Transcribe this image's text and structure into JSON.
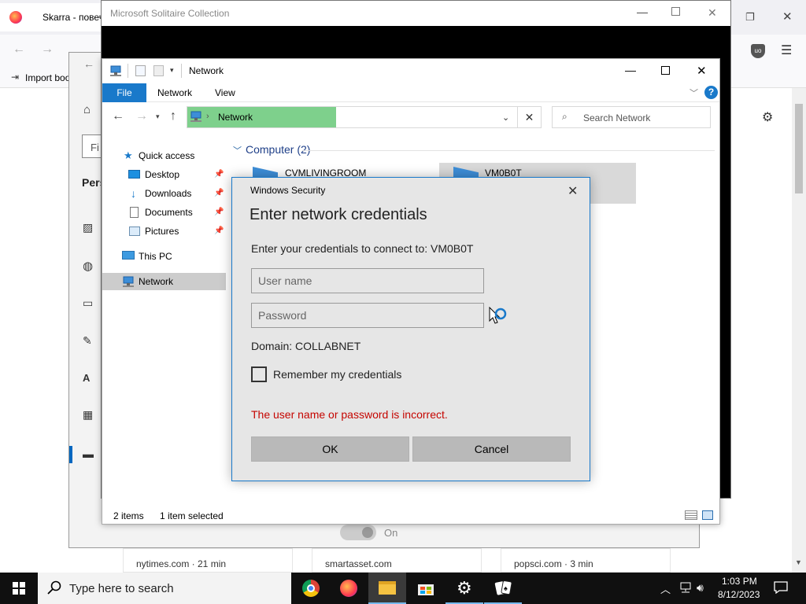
{
  "browser": {
    "tab_title": "Skarra - повеч",
    "bookmark_import": "Import boo",
    "settings_heading": "Pers",
    "settings_input_hint": "Fi",
    "toggle_label": "On",
    "cards": [
      {
        "label": "nytimes.com · 21 min"
      },
      {
        "label": "smartasset.com"
      },
      {
        "label": "popsci.com · 3 min"
      }
    ]
  },
  "solitaire": {
    "title": "Microsoft Solitaire Collection"
  },
  "explorer": {
    "title": "Network",
    "ribbon": {
      "file": "File",
      "network": "Network",
      "view": "View"
    },
    "address": "Network",
    "search_placeholder": "Search Network",
    "nav": {
      "quick_access": "Quick access",
      "desktop": "Desktop",
      "downloads": "Downloads",
      "documents": "Documents",
      "pictures": "Pictures",
      "this_pc": "This PC",
      "network": "Network"
    },
    "group_header": "Computer (2)",
    "computers": [
      {
        "name": "CVMLIVINGROOM"
      },
      {
        "name": "VM0B0T"
      }
    ],
    "status": {
      "items": "2 items",
      "selected": "1 item selected"
    }
  },
  "dialog": {
    "caption": "Windows Security",
    "heading": "Enter network credentials",
    "prompt": "Enter your credentials to connect to: VM0B0T",
    "username_placeholder": "User name",
    "password_placeholder": "Password",
    "domain": "Domain: COLLABNET",
    "remember": "Remember my credentials",
    "error": "The user name or password is incorrect.",
    "ok": "OK",
    "cancel": "Cancel",
    "error_color": "#c50500"
  },
  "taskbar": {
    "search_placeholder": "Type here to search",
    "time": "1:03 PM",
    "date": "8/12/2023"
  }
}
